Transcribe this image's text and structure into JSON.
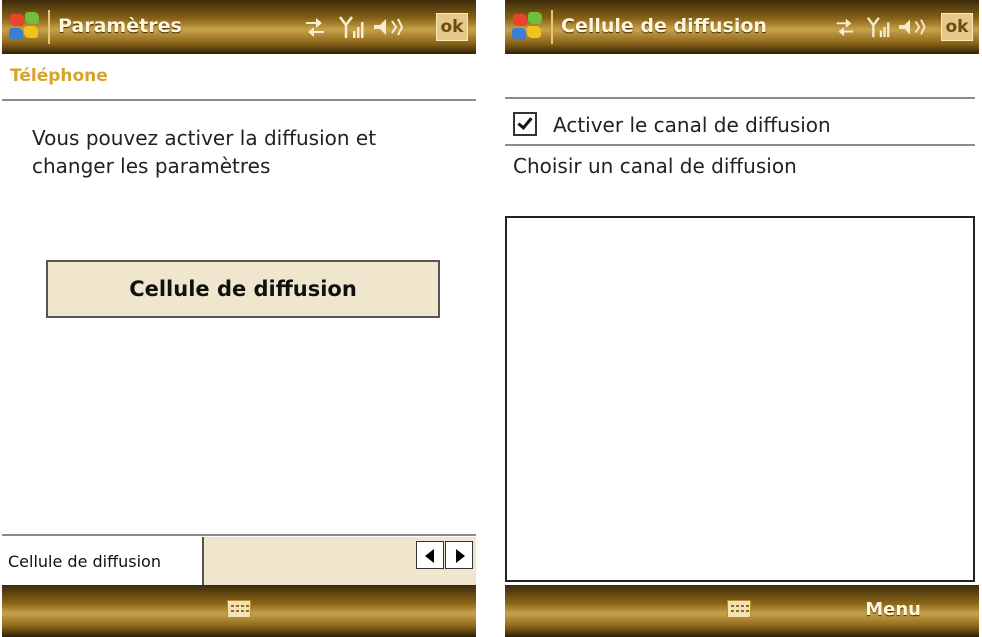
{
  "left": {
    "title": "Paramètres",
    "ok": "ok",
    "section": "Téléphone",
    "description": "Vous pouvez activer la diffusion et changer les paramètres",
    "button": "Cellule de diffusion",
    "field_label": "Cellule de diffusion"
  },
  "right": {
    "title": "Cellule de diffusion",
    "ok": "ok",
    "checkbox_label": "Activer le canal de diffusion",
    "checkbox_checked": true,
    "choose_label": "Choisir un canal de diffusion",
    "menu": "Menu"
  },
  "icons": {
    "start": "windows-start-icon",
    "connectivity": "connectivity-arrows-icon",
    "signal": "signal-strength-icon",
    "volume": "speaker-icon",
    "keyboard": "keyboard-icon"
  },
  "colors": {
    "bar_gold": "#8a6518",
    "section_header": "#d6a32b",
    "button_bg": "#efe6cd"
  }
}
